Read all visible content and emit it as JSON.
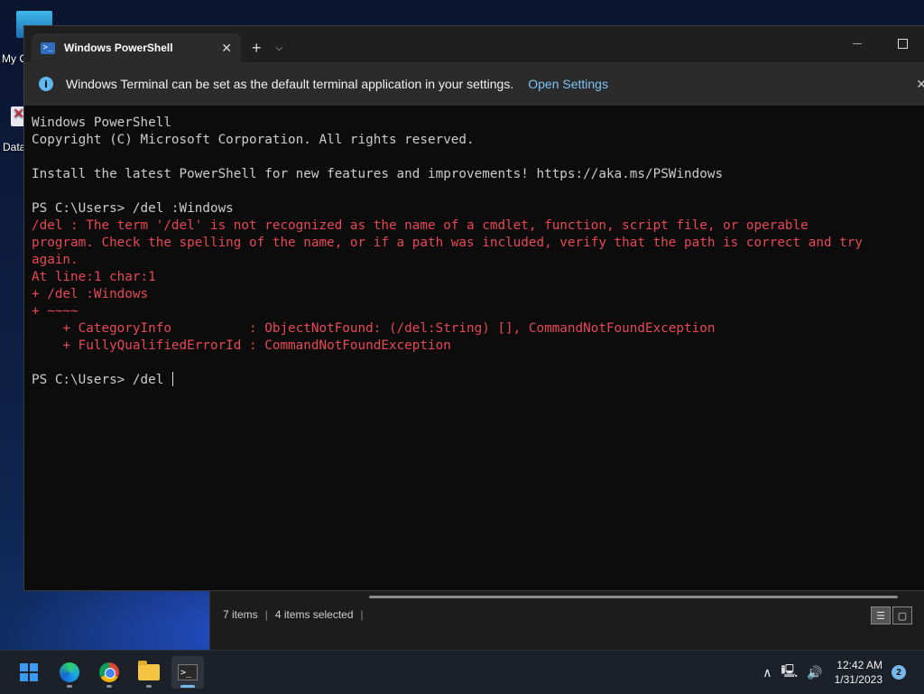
{
  "desktop": {
    "icons": [
      {
        "label": "My C"
      },
      {
        "label": "Data"
      }
    ]
  },
  "terminal": {
    "tab_title": "Windows PowerShell",
    "tab_close": "✕",
    "new_tab": "+",
    "dropdown": "⌵",
    "minimize": "—",
    "infobar": {
      "icon": "i",
      "message": "Windows Terminal can be set as the default terminal application in your settings.",
      "link": "Open Settings",
      "close": "✕"
    },
    "lines": [
      {
        "text": "Windows PowerShell",
        "type": "normal"
      },
      {
        "text": "Copyright (C) Microsoft Corporation. All rights reserved.",
        "type": "normal"
      },
      {
        "text": "",
        "type": "normal"
      },
      {
        "text": "Install the latest PowerShell for new features and improvements! https://aka.ms/PSWindows",
        "type": "normal"
      },
      {
        "text": "",
        "type": "normal"
      },
      {
        "text": "PS C:\\Users> /del :Windows",
        "type": "normal"
      },
      {
        "text": "/del : The term '/del' is not recognized as the name of a cmdlet, function, script file, or operable",
        "type": "error"
      },
      {
        "text": "program. Check the spelling of the name, or if a path was included, verify that the path is correct and try",
        "type": "error"
      },
      {
        "text": "again.",
        "type": "error"
      },
      {
        "text": "At line:1 char:1",
        "type": "error"
      },
      {
        "text": "+ /del :Windows",
        "type": "error"
      },
      {
        "text": "+ ~~~~",
        "type": "error"
      },
      {
        "text": "    + CategoryInfo          : ObjectNotFound: (/del:String) [], CommandNotFoundException",
        "type": "error"
      },
      {
        "text": "    + FullyQualifiedErrorId : CommandNotFoundException",
        "type": "error"
      },
      {
        "text": "",
        "type": "normal"
      }
    ],
    "prompt": "PS C:\\Users> /del "
  },
  "explorer": {
    "items_count": "7 items",
    "selected": "4 items selected",
    "sep": "|"
  },
  "taskbar": {
    "apps": [
      "start-icon",
      "edge-icon",
      "chrome-icon",
      "file-explorer-icon",
      "terminal-icon"
    ],
    "tray": {
      "chevron": "∧",
      "time": "12:42 AM",
      "date": "1/31/2023",
      "notifications": "2"
    }
  }
}
